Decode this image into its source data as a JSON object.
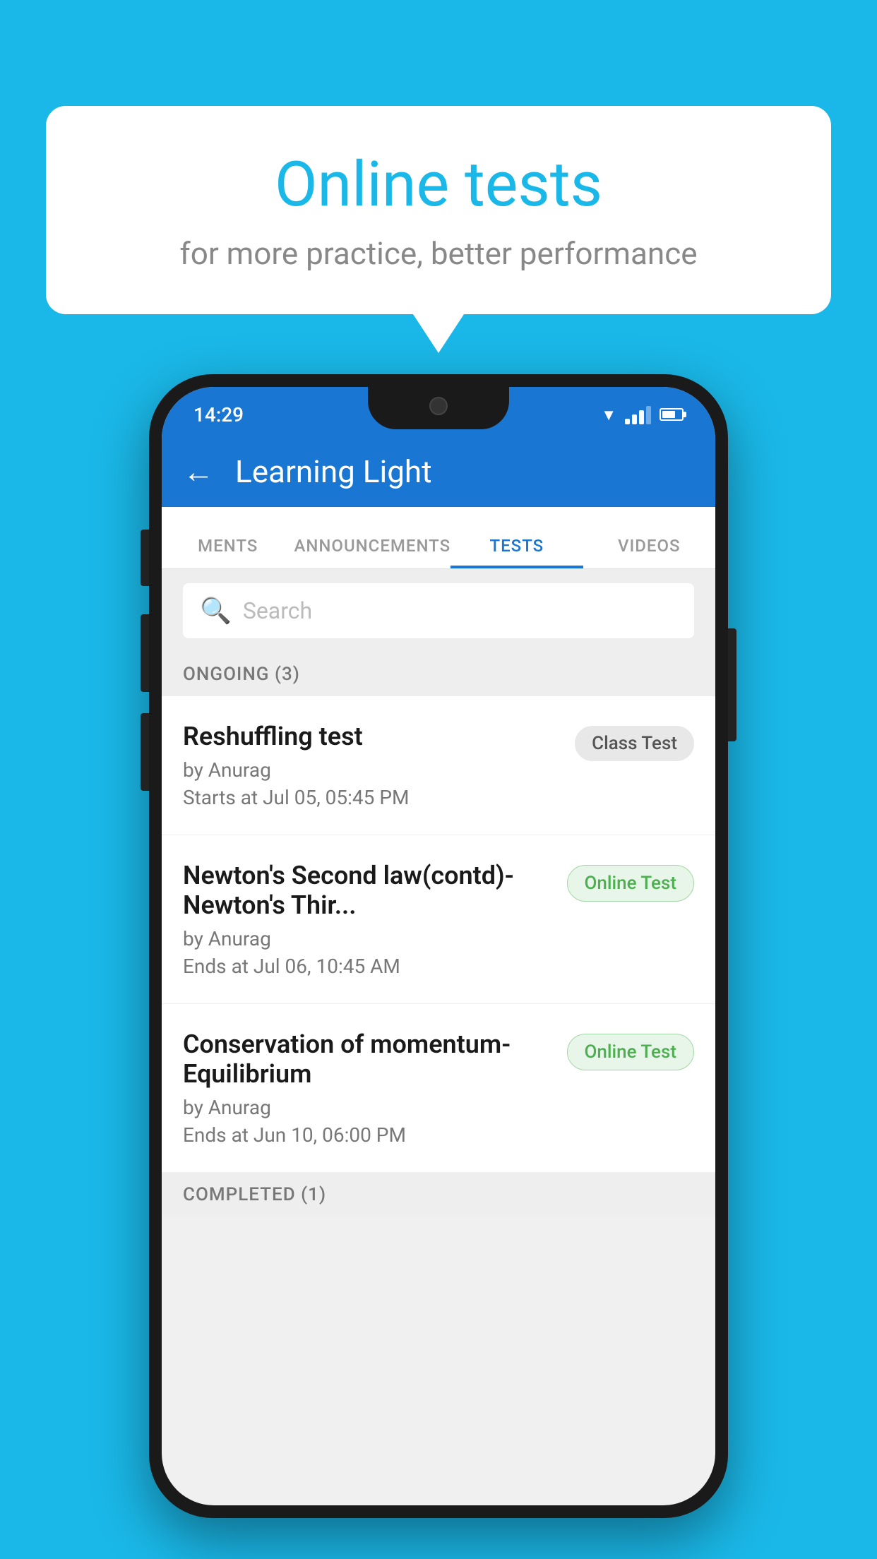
{
  "background": {
    "color": "#1ab8e8"
  },
  "speech_bubble": {
    "title": "Online tests",
    "subtitle": "for more practice, better performance"
  },
  "phone": {
    "status_bar": {
      "time": "14:29"
    },
    "app_bar": {
      "title": "Learning Light"
    },
    "tabs": [
      {
        "label": "MENTS",
        "active": false
      },
      {
        "label": "ANNOUNCEMENTS",
        "active": false
      },
      {
        "label": "TESTS",
        "active": true
      },
      {
        "label": "VIDEOS",
        "active": false
      }
    ],
    "search": {
      "placeholder": "Search"
    },
    "ongoing_section": {
      "label": "ONGOING (3)"
    },
    "tests": [
      {
        "name": "Reshuffling test",
        "author": "by Anurag",
        "date": "Starts at  Jul 05, 05:45 PM",
        "badge_label": "Class Test",
        "badge_type": "class"
      },
      {
        "name": "Newton's Second law(contd)-Newton's Thir...",
        "author": "by Anurag",
        "date": "Ends at  Jul 06, 10:45 AM",
        "badge_label": "Online Test",
        "badge_type": "online"
      },
      {
        "name": "Conservation of momentum-Equilibrium",
        "author": "by Anurag",
        "date": "Ends at  Jun 10, 06:00 PM",
        "badge_label": "Online Test",
        "badge_type": "online"
      }
    ],
    "completed_section": {
      "label": "COMPLETED (1)"
    }
  }
}
